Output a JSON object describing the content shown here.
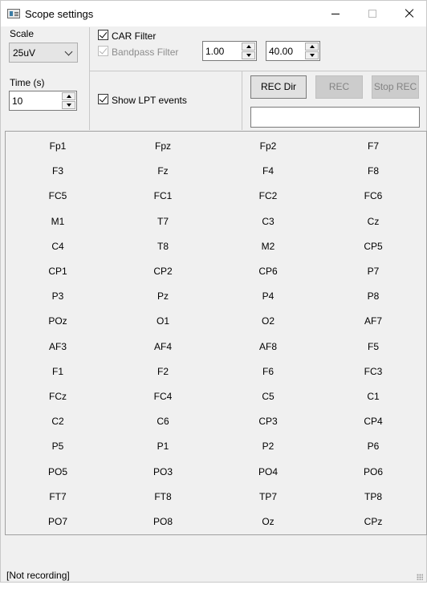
{
  "window": {
    "title": "Scope settings"
  },
  "scale": {
    "label": "Scale",
    "value": "25uV"
  },
  "time": {
    "label": "Time (s)",
    "value": "10"
  },
  "filters": {
    "car_label": "CAR Filter",
    "bandpass_label": "Bandpass Filter",
    "low": "1.00",
    "high": "40.00",
    "show_lpt_label": "Show LPT events"
  },
  "recording": {
    "rec_dir": "REC Dir",
    "rec": "REC",
    "stop_rec": "Stop REC",
    "path": ""
  },
  "channels": [
    "Fp1",
    "Fpz",
    "Fp2",
    "F7",
    "F3",
    "Fz",
    "F4",
    "F8",
    "FC5",
    "FC1",
    "FC2",
    "FC6",
    "M1",
    "T7",
    "C3",
    "Cz",
    "C4",
    "T8",
    "M2",
    "CP5",
    "CP1",
    "CP2",
    "CP6",
    "P7",
    "P3",
    "Pz",
    "P4",
    "P8",
    "POz",
    "O1",
    "O2",
    "AF7",
    "AF3",
    "AF4",
    "AF8",
    "F5",
    "F1",
    "F2",
    "F6",
    "FC3",
    "FCz",
    "FC4",
    "C5",
    "C1",
    "C2",
    "C6",
    "CP3",
    "CP4",
    "P5",
    "P1",
    "P2",
    "P6",
    "PO5",
    "PO3",
    "PO4",
    "PO6",
    "FT7",
    "FT8",
    "TP7",
    "TP8",
    "PO7",
    "PO8",
    "Oz",
    "CPz"
  ],
  "status": "[Not recording]"
}
